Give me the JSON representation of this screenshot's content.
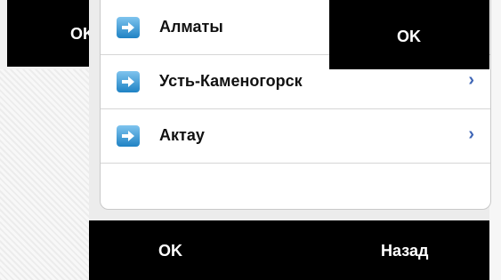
{
  "left_bar": {
    "ok_label": "OK"
  },
  "top_right_bar": {
    "ok_label": "OK"
  },
  "list": {
    "items": [
      {
        "label": "Алматы",
        "icon": "arrow-right-icon",
        "has_chevron": false
      },
      {
        "label": "Усть-Каменогорск",
        "icon": "arrow-right-icon",
        "has_chevron": true
      },
      {
        "label": "Актау",
        "icon": "arrow-right-icon",
        "has_chevron": true
      }
    ],
    "chevron_glyph": "›"
  },
  "bottom_bar": {
    "ok_label": "OK",
    "back_label": "Назад"
  },
  "colors": {
    "bar": "#000000",
    "icon_accent": "#1f82c4",
    "chevron": "#3f66b6"
  }
}
